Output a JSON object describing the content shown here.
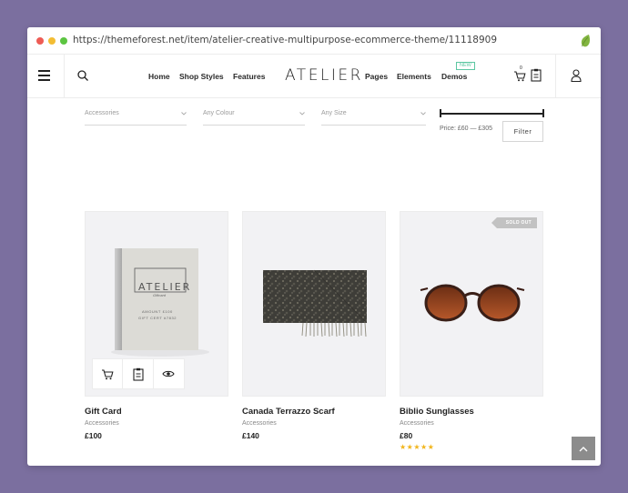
{
  "browser": {
    "url": "https://themeforest.net/item/atelier-creative-multipurpose-ecommerce-theme/11118909"
  },
  "header": {
    "logo": "ATELIER",
    "nav_left": [
      "Home",
      "Shop Styles",
      "Features"
    ],
    "nav_right": [
      "Pages",
      "Elements",
      "Demos"
    ],
    "new_badge": "NEW",
    "cart_count": "0",
    "icons": [
      "menu-icon",
      "search-icon",
      "cart-icon",
      "wishlist-icon",
      "account-icon"
    ]
  },
  "filters": {
    "category_placeholder": "Accessories",
    "colour_placeholder": "Any Colour",
    "size_placeholder": "Any Size",
    "price_label": "Price: £60 — £305",
    "filter_button": "Filter"
  },
  "products": [
    {
      "name": "Gift Card",
      "category": "Accessories",
      "price": "£100",
      "book_title": "ATELIER",
      "book_sub": "Giftcard",
      "book_line1": "AMOUNT £100",
      "book_line2": "GIFT CERT #7832"
    },
    {
      "name": "Canada Terrazzo Scarf",
      "category": "Accessories",
      "price": "£140"
    },
    {
      "name": "Biblio Sunglasses",
      "category": "Accessories",
      "price": "£80",
      "badge": "SOLD OUT",
      "rating": "★★★★★"
    }
  ],
  "colors": {
    "background": "#7b6f9f",
    "accent_new": "#5cc7a2",
    "star": "#f1b51c"
  }
}
